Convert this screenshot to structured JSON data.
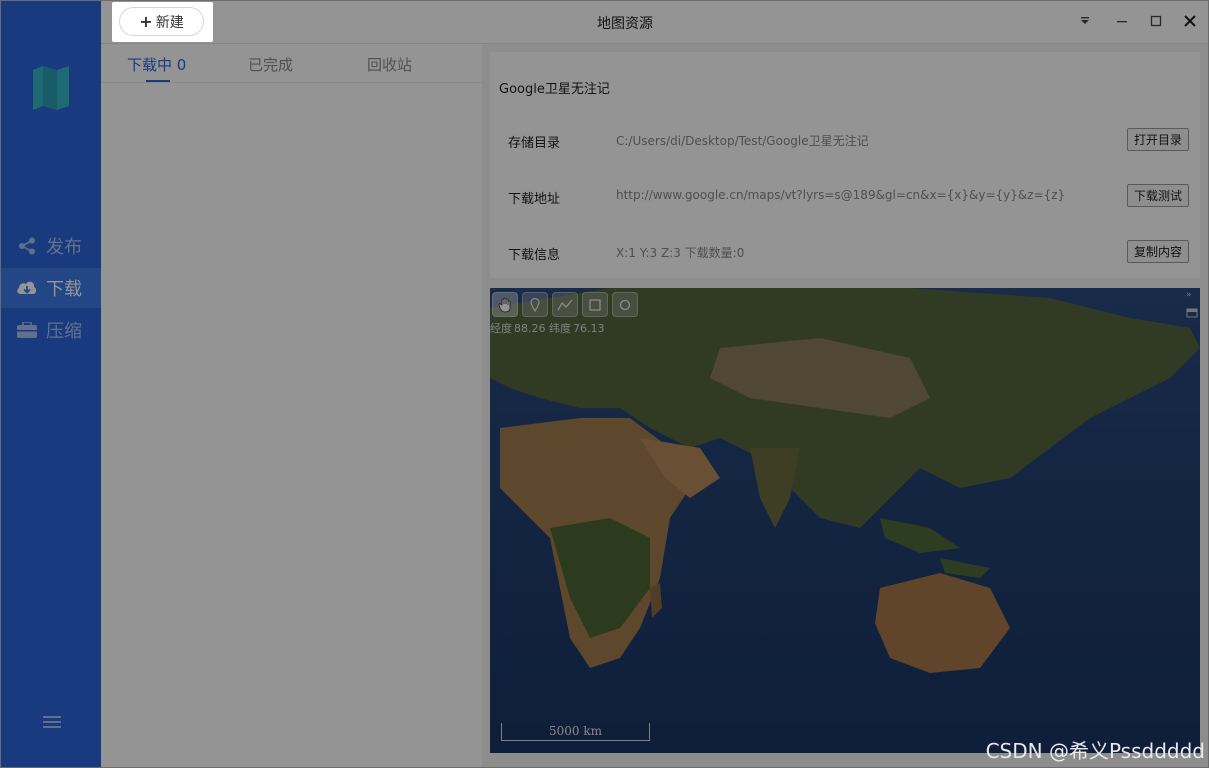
{
  "window": {
    "title": "地图资源"
  },
  "toolbar": {
    "new_label": "新建",
    "new_icon": "plus-icon"
  },
  "sidebar": {
    "logo_icon": "map-book-icon",
    "items": [
      {
        "label": "发布",
        "icon": "share-icon",
        "active": false
      },
      {
        "label": "下载",
        "icon": "cloud-download-icon",
        "active": true
      },
      {
        "label": "压缩",
        "icon": "briefcase-icon",
        "active": false
      }
    ],
    "menu_icon": "hamburger-icon"
  },
  "tabs": [
    {
      "label": "下载中 0",
      "active": true
    },
    {
      "label": "已完成",
      "active": false
    },
    {
      "label": "回收站",
      "active": false
    }
  ],
  "resource": {
    "name": "Google卫星无注记",
    "rows": [
      {
        "label": "存储目录",
        "value": "C:/Users/di/Desktop/Test/Google卫星无注记",
        "button": "打开目录"
      },
      {
        "label": "下载地址",
        "value": "http://www.google.cn/maps/vt?lyrs=s@189&gl=cn&x={x}&y={y}&z={z}",
        "button": "下载测试"
      },
      {
        "label": "下载信息",
        "value": "X:1   Y:3   Z:3   下载数量:0",
        "button": "复制内容"
      }
    ]
  },
  "map": {
    "tools": [
      "hand-pan-icon",
      "marker-icon",
      "polyline-icon",
      "rectangle-icon",
      "circle-icon"
    ],
    "coords": {
      "lon_label": "经度",
      "lon": "88.26",
      "lat_label": "纬度",
      "lat": "76.13"
    },
    "scale_label": "5000 km"
  },
  "watermark": "CSDN @希义Pssddddd",
  "colors": {
    "sidebar": "#2b65d9",
    "accent": "#2b65d9"
  }
}
